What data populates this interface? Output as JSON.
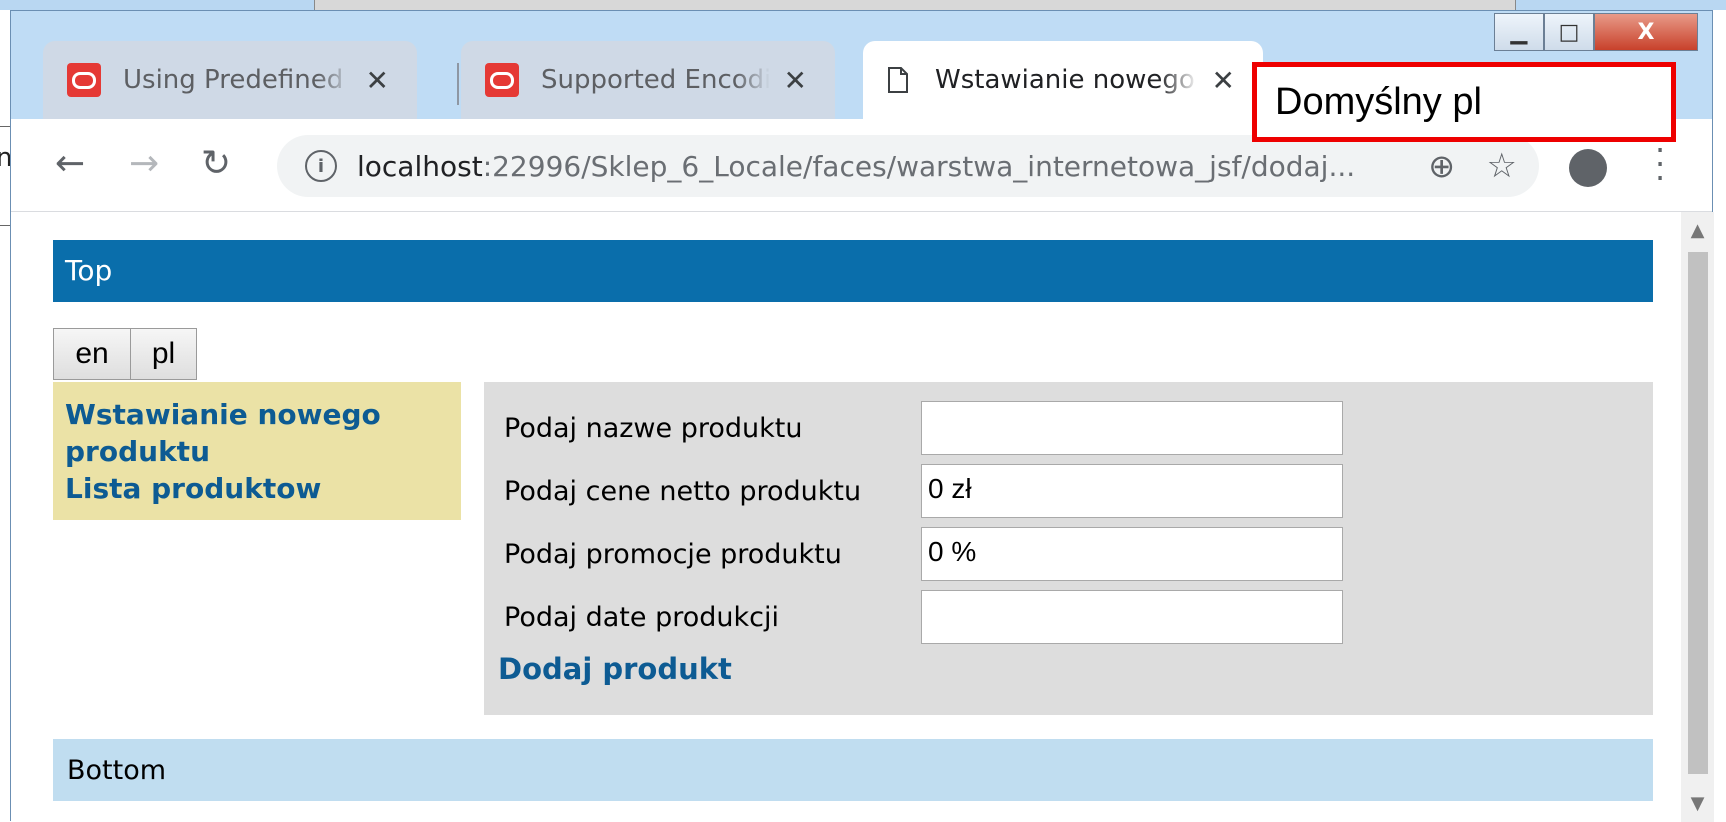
{
  "browser": {
    "tabs": [
      {
        "title": "Using Predefined For",
        "icon": "oracle-icon",
        "active": false
      },
      {
        "title": "Supported Encodings",
        "icon": "oracle-icon",
        "active": false
      },
      {
        "title": "Wstawianie nowego p",
        "icon": "document-icon",
        "active": true
      }
    ],
    "tab_close_glyph": "✕",
    "address": {
      "host": "localhost",
      "path": ":22996/Sklep_6_Locale/faces/warstwa_internetowa_jsf/dodaj..."
    },
    "window_controls": {
      "minimize": "▁",
      "maximize": "□",
      "close": "X"
    }
  },
  "callout": {
    "text": "Domyślny pl",
    "border_color": "#ee0000"
  },
  "page": {
    "top_band": "Top",
    "languages": [
      "en",
      "pl"
    ],
    "sidebar_links": [
      "Wstawianie nowego produktu",
      "Lista produktow"
    ],
    "form": {
      "fields": [
        {
          "label": "Podaj nazwe produktu",
          "value": ""
        },
        {
          "label": "Podaj cene netto produktu",
          "value": "0 zł"
        },
        {
          "label": "Podaj promocje produktu",
          "value": "0 %"
        },
        {
          "label": "Podaj date produkcji",
          "value": ""
        }
      ],
      "submit_label": "Dodaj produkt"
    },
    "bottom_band": "Bottom"
  },
  "colors": {
    "top_band": "#0a6eab",
    "sidebar": "#ebe2a6",
    "panel": "#dddddd",
    "bottom_band": "#c0ddf0",
    "link": "#0d5b93"
  },
  "background_app": {
    "partial_text": "n"
  }
}
